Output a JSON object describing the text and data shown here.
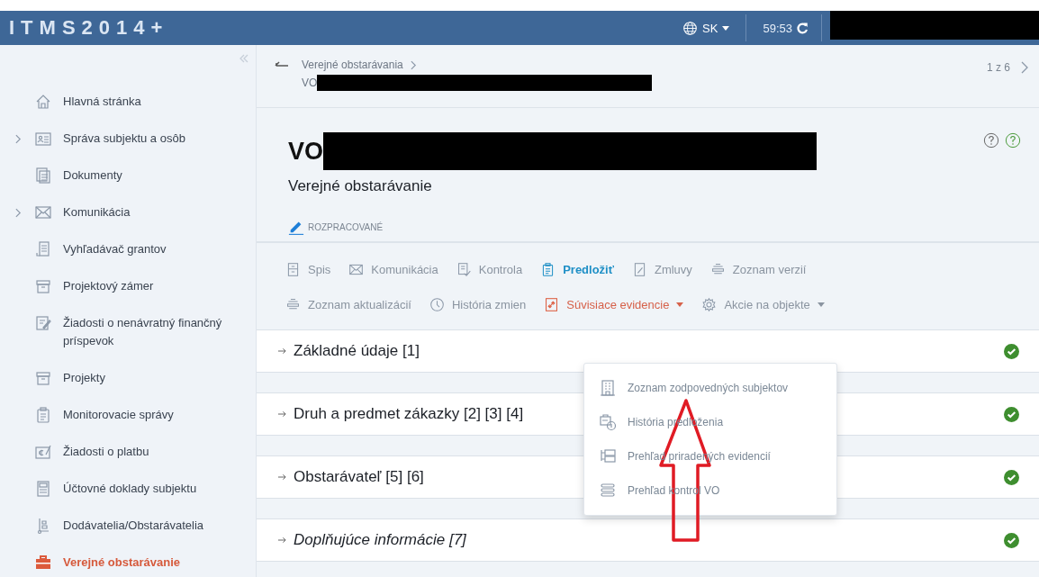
{
  "header": {
    "logo": "ITMS2014+",
    "language": "SK",
    "session_timer": "59:53"
  },
  "sidebar": {
    "items": [
      {
        "label": "Hlavná stránka",
        "expandable": false,
        "selected": false
      },
      {
        "label": "Správa subjektu a osôb",
        "expandable": true,
        "selected": false
      },
      {
        "label": "Dokumenty",
        "expandable": false,
        "selected": false
      },
      {
        "label": "Komunikácia",
        "expandable": true,
        "selected": false
      },
      {
        "label": "Vyhľadávač grantov",
        "expandable": false,
        "selected": false
      },
      {
        "label": "Projektový zámer",
        "expandable": false,
        "selected": false
      },
      {
        "label": "Žiadosti o nenávratný finančný príspevok",
        "expandable": false,
        "selected": false
      },
      {
        "label": "Projekty",
        "expandable": false,
        "selected": false
      },
      {
        "label": "Monitorovacie správy",
        "expandable": false,
        "selected": false
      },
      {
        "label": "Žiadosti o platbu",
        "expandable": false,
        "selected": false
      },
      {
        "label": "Účtovné doklady subjektu",
        "expandable": false,
        "selected": false
      },
      {
        "label": "Dodávatelia/Obstarávatelia",
        "expandable": false,
        "selected": false
      },
      {
        "label": "Verejné obstarávanie",
        "expandable": false,
        "selected": true
      }
    ]
  },
  "breadcrumb": {
    "parent": "Verejné obstarávania",
    "current": "VO",
    "pager": "1 z 6"
  },
  "record": {
    "title": "VO",
    "subtitle": "Verejné obstarávanie",
    "status": "ROZPRACOVANÉ"
  },
  "toolbar": [
    [
      {
        "label": "Spis",
        "kind": "plain"
      },
      {
        "label": "Komunikácia",
        "kind": "plain"
      },
      {
        "label": "Kontrola",
        "kind": "plain"
      },
      {
        "label": "Predložiť",
        "kind": "primary"
      },
      {
        "label": "Zmluvy",
        "kind": "plain"
      },
      {
        "label": "Zoznam verzií",
        "kind": "plain"
      }
    ],
    [
      {
        "label": "Zoznam aktualizácií",
        "kind": "plain"
      },
      {
        "label": "História zmien",
        "kind": "plain"
      },
      {
        "label": "Súvisiace evidencie",
        "kind": "menu-open"
      },
      {
        "label": "Akcie na objekte",
        "kind": "menu"
      }
    ]
  ],
  "related_menu": [
    {
      "label": "Zoznam zodpovedných subjektov"
    },
    {
      "label": "História predloženia"
    },
    {
      "label": "Prehľad priradených evidencií"
    },
    {
      "label": "Prehľad kontrol VO"
    }
  ],
  "sections": [
    {
      "title": "Základné údaje [1]",
      "italic": false,
      "complete": true
    },
    {
      "title": "Druh a predmet zákazky [2] [3] [4]",
      "italic": false,
      "complete": true
    },
    {
      "title": "Obstarávateľ [5] [6]",
      "italic": false,
      "complete": true
    },
    {
      "title": "Doplňujúce informácie [7]",
      "italic": true,
      "complete": true
    }
  ]
}
